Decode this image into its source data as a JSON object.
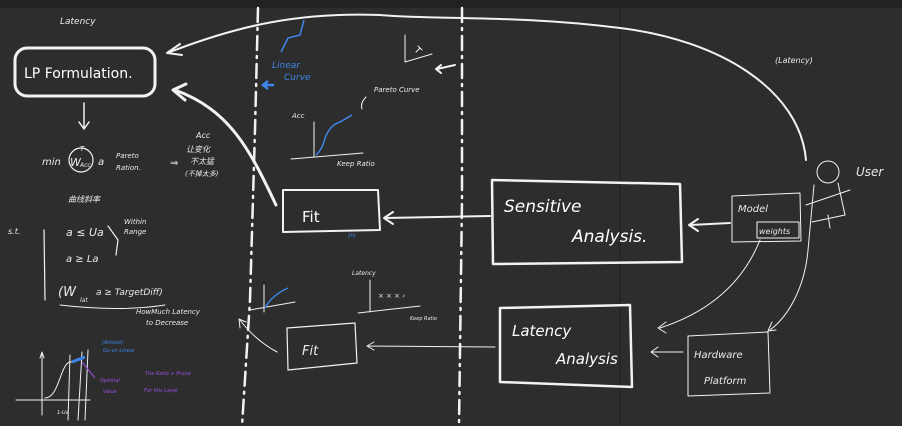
{
  "colors": {
    "background": "#2d2d2d",
    "ink": "#f2f2f2",
    "blue": "#3d86e8",
    "purple": "#9a4fe0"
  },
  "left_panel": {
    "latency_note": "Latency",
    "lp_box": "LP  Formulation.",
    "objective": {
      "min": "min",
      "w_acc": "W",
      "acc_sub": "Acc",
      "T": "T",
      "a": "a",
      "pareto": "Pareto",
      "ration": "Ration.",
      "note_title": "Acc",
      "note_lines": [
        "让变化",
        "不太猛",
        "(不掉太多)"
      ],
      "below": "曲线斜率"
    },
    "constraints": {
      "st": "s.t.",
      "c1": "a ≤ Ua",
      "c2": "a ≥ La",
      "within": "Within",
      "range": "Range",
      "c3": "(W",
      "lat_sub": "lat",
      "c3_rest": "a ≥ TargetDiff)",
      "howmuch": "HowMuch Latency",
      "decrease": "to Decrease"
    },
    "curve": {
      "blue_top": "(Almost)",
      "blue_bottom": "Go on Linear",
      "optimal": "Optimal",
      "value": "Value",
      "purple_1": "The Ratio + Prune",
      "purple_2": "For this Layer",
      "axis": "1-Ua"
    }
  },
  "middle": {
    "linear_curve": [
      "Linear",
      "Curve"
    ],
    "pareto_curve": "Pareto Curve",
    "acc": "Acc",
    "keep_ratio": "Keep Ratio",
    "fit_top": "Fit",
    "fit_top_note": "(*)",
    "latency": "Latency",
    "keep_ratio_2": "Keep Ratio",
    "fit_bottom": "Fit"
  },
  "right": {
    "sensitive": [
      "Sensitive",
      "Analysis."
    ],
    "latency_analysis": [
      "Latency",
      "Analysis"
    ],
    "model": "Model",
    "weights": "weights",
    "user": "User",
    "latency_note": "(Latency)",
    "hardware": [
      "Hardware",
      "Platform"
    ]
  }
}
